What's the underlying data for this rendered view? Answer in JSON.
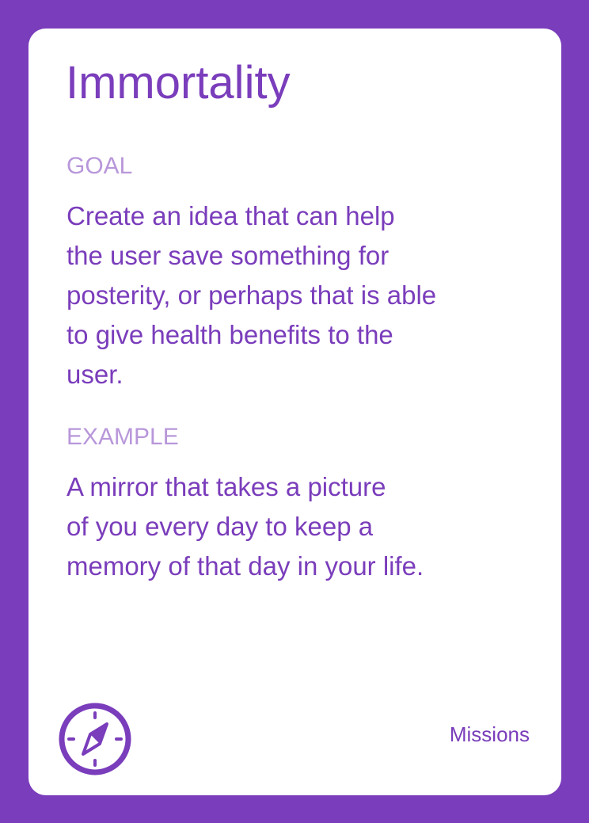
{
  "card": {
    "title": "Immortality",
    "goal": {
      "label": "GOAL",
      "lines": [
        "Create an idea that can help",
        "the user save something for",
        "posterity, or perhaps that is able",
        "to give health benefits to the",
        "user."
      ]
    },
    "example": {
      "label": "EXAMPLE",
      "lines": [
        "A mirror that takes a picture",
        "of you every day to keep a",
        "memory of that day in your life."
      ]
    },
    "footer": {
      "icon": "compass-icon",
      "category": "Missions"
    }
  },
  "colors": {
    "background": "#7a3dbb",
    "accent": "#7a3dbb",
    "label": "#b897da",
    "card": "#ffffff"
  }
}
